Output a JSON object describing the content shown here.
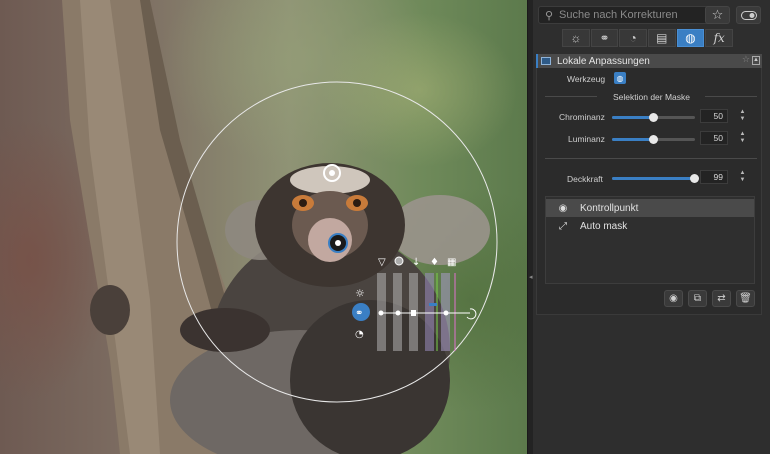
{
  "search": {
    "placeholder": "Suche nach Korrekturen"
  },
  "header_icons": {
    "favorite": "star-icon",
    "toggle": "toggle-icon"
  },
  "tabs": [
    {
      "icon": "sun-icon",
      "glyph": "☼",
      "active": false
    },
    {
      "icon": "color-circles-icon",
      "glyph": "⚭",
      "active": false
    },
    {
      "icon": "detail-icon",
      "glyph": "◔",
      "active": false
    },
    {
      "icon": "layers-icon",
      "glyph": "▤",
      "active": false
    },
    {
      "icon": "local-adjust-icon",
      "glyph": "◍",
      "active": true
    },
    {
      "icon": "fx-icon",
      "glyph": "fx",
      "active": false
    }
  ],
  "section": {
    "title": "Lokale Anpassungen"
  },
  "tool": {
    "label": "Werkzeug"
  },
  "mask": {
    "heading": "Selektion der Maske",
    "chrominance": {
      "label": "Chrominanz",
      "value": "50",
      "fraction": 0.5
    },
    "luminance": {
      "label": "Luminanz",
      "value": "50",
      "fraction": 0.5
    }
  },
  "opacity": {
    "label": "Deckkraft",
    "value": "99",
    "fraction": 0.99
  },
  "list": [
    {
      "label": "Kontrollpunkt",
      "icon": "control-point-icon",
      "selected": true
    },
    {
      "label": "Auto mask",
      "icon": "auto-mask-icon",
      "selected": false
    }
  ],
  "actions": [
    "eye-icon",
    "duplicate-icon",
    "swap-icon",
    "trash-icon"
  ],
  "accent": "#3a7fc4"
}
